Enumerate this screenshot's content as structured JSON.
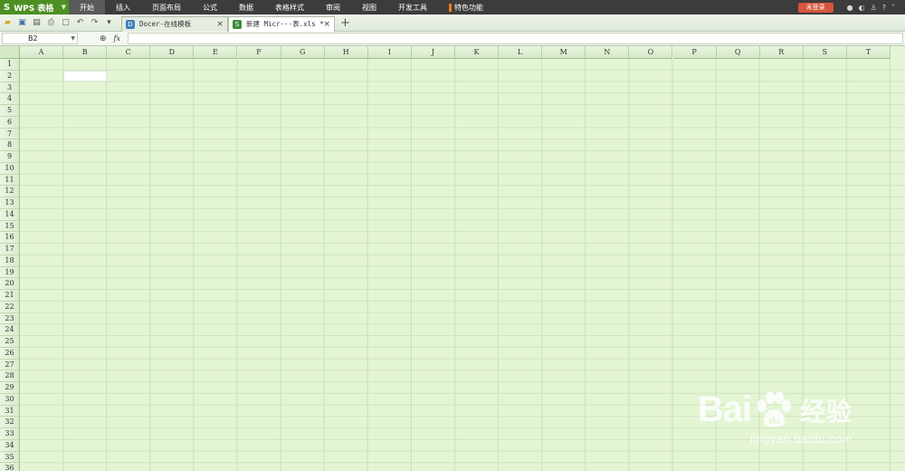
{
  "app": {
    "name": "WPS 表格",
    "logo_glyph": "S"
  },
  "menu": {
    "items": [
      "开始",
      "插入",
      "页面布局",
      "公式",
      "数据",
      "表格样式",
      "审阅",
      "视图",
      "开发工具",
      "特色功能"
    ],
    "active_index": 0,
    "login_label": "未登录"
  },
  "tabs": {
    "docer_label": "Docer-在线模板",
    "file_label": "新建 Micr···表.xls *"
  },
  "formula_bar": {
    "cell_ref": "B2",
    "fx_label": "fx",
    "formula_value": ""
  },
  "sheet": {
    "columns": [
      "A",
      "B",
      "C",
      "D",
      "E",
      "F",
      "G",
      "H",
      "I",
      "J",
      "K",
      "L",
      "M",
      "N",
      "O",
      "P",
      "Q",
      "R",
      "S",
      "T"
    ],
    "row_count": 36,
    "active_cell": "B2"
  },
  "watermark": {
    "brand_main": "Bai",
    "brand_suffix": "du",
    "brand_cn": "经验",
    "url": "jingyan.baidu.com"
  }
}
